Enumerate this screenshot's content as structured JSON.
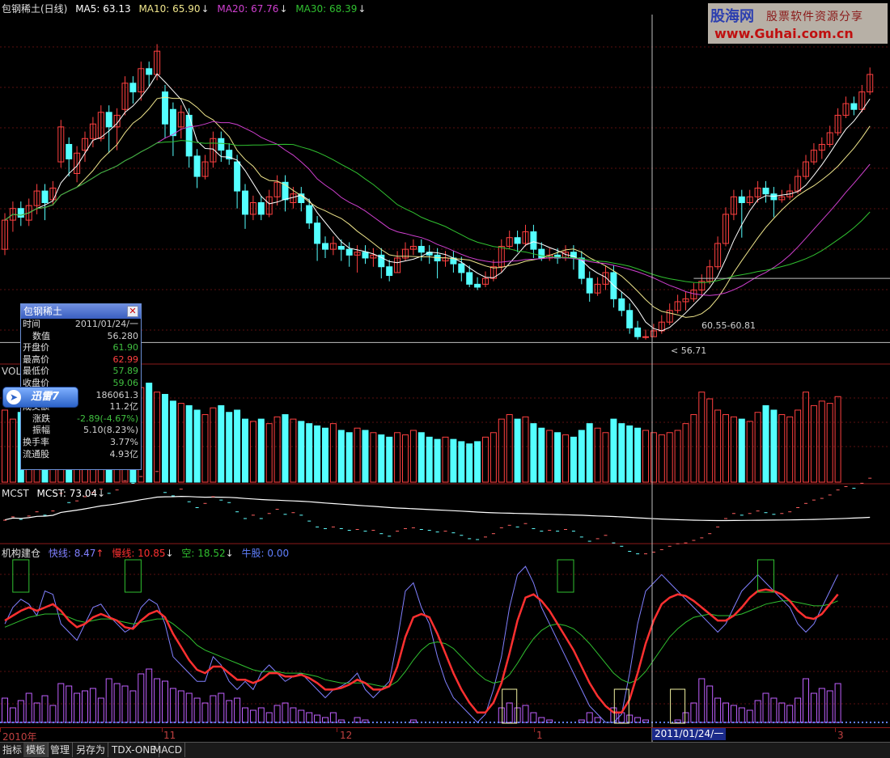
{
  "window": {
    "title": "包钢稀土(日线)"
  },
  "price_panel": {
    "name": "包钢稀土(日线)",
    "ma5_label": "MA5: 63.13",
    "ma10_label": "MA10: 65.90",
    "ma20_label": "MA20: 67.76",
    "ma30_label": "MA30: 68.39",
    "arrow": "↓",
    "ann_range": "60.55-60.81",
    "ann_low": "56.71",
    "colors": {
      "ma5": "#ffffff",
      "ma10": "#f0e68c",
      "ma20": "#d040d0",
      "ma30": "#30c030",
      "up": "#ff4040",
      "down": "#54ffff"
    }
  },
  "vol_panel": {
    "title": "VOL"
  },
  "mcst_panel": {
    "title": "MCST",
    "label": "MCST: 73.04",
    "arrow": "↓"
  },
  "jigou_panel": {
    "title": "机构建仓",
    "fast_label": "快线: 8.47",
    "fast_arrow": "↑",
    "slow_label": "慢线: 10.85",
    "slow_arrow": "↓",
    "kong_label": "空: 18.52",
    "kong_arrow": "↓",
    "niu_label": "牛股: 0.00",
    "colors": {
      "fast": "#8080ff",
      "slow": "#ff3030",
      "kong": "#30c030",
      "niu": "#6080ff"
    }
  },
  "info_box": {
    "title": "包钢稀土",
    "close_icon": "close-icon",
    "rows": [
      {
        "label": "时间",
        "value": "2011/01/24/一",
        "color": "#d0d0d0"
      },
      {
        "label": "数值",
        "value": "56.280",
        "color": "#d0d0d0"
      },
      {
        "label": "开盘价",
        "value": "61.90",
        "color": "#40c040"
      },
      {
        "label": "最高价",
        "value": "62.99",
        "color": "#ff4040"
      },
      {
        "label": "最低价",
        "value": "57.89",
        "color": "#40c040"
      },
      {
        "label": "收盘价",
        "value": "59.06",
        "color": "#40c040"
      },
      {
        "label": "成交量",
        "value": "186061.3",
        "color": "#d0d0d0"
      },
      {
        "label": "成交额",
        "value": "11.2亿",
        "color": "#d0d0d0"
      },
      {
        "label": "涨跌",
        "value": "-2.89(-4.67%)",
        "color": "#40c040"
      },
      {
        "label": "振幅",
        "value": "5.10(8.23%)",
        "color": "#d0d0d0"
      },
      {
        "label": "换手率",
        "value": "3.77%",
        "color": "#d0d0d0"
      },
      {
        "label": "流通股",
        "value": "4.93亿",
        "color": "#d0d0d0"
      }
    ]
  },
  "xunlei": {
    "label": "迅雷7",
    "icon": "xunlei-bird-icon"
  },
  "watermark": {
    "logo": "股海网",
    "slogan": "股票软件资源分享",
    "url": "www.Guhai.com.cn"
  },
  "date_axis": {
    "ticks": [
      "2010年",
      "11",
      "12",
      "1",
      "2011/01/24/一",
      "3"
    ]
  },
  "toolbar": {
    "buttons": [
      "指标",
      "模板",
      "管理",
      "另存为",
      "TDX-ONE",
      "MACD"
    ]
  },
  "chart_data": [
    {
      "type": "candlestick",
      "title": "包钢稀土(日线)",
      "series_names": [
        "MA5",
        "MA10",
        "MA20",
        "MA30"
      ],
      "candles_ocl": [
        [
          57.0,
          62.0,
          56.0
        ],
        [
          62.0,
          64.0,
          60.0
        ],
        [
          64.0,
          62.5,
          61.0
        ],
        [
          62.0,
          64.5,
          61.0
        ],
        [
          64.5,
          67.0,
          63.0
        ],
        [
          67.0,
          65.0,
          62.0
        ],
        [
          65.5,
          67.5,
          64.5
        ],
        [
          72.0,
          78.0,
          71.0
        ],
        [
          75.0,
          72.5,
          69.5
        ],
        [
          70.0,
          73.5,
          68.5
        ],
        [
          74.0,
          76.0,
          72.0
        ],
        [
          76.0,
          78.5,
          74.5
        ],
        [
          76.0,
          80.5,
          75.5
        ],
        [
          80.5,
          78.0,
          73.5
        ],
        [
          78.0,
          80.0,
          74.0
        ],
        [
          81.0,
          85.5,
          80.0
        ],
        [
          85.5,
          84.0,
          82.0
        ],
        [
          84.0,
          88.0,
          82.5
        ],
        [
          88.0,
          87.0,
          85.0
        ],
        [
          87.0,
          91.0,
          86.0
        ],
        [
          84.0,
          78.5,
          76.0
        ],
        [
          81.0,
          76.5,
          73.0
        ],
        [
          78.0,
          80.5,
          76.0
        ],
        [
          80.0,
          73.0,
          71.0
        ],
        [
          73.0,
          69.5,
          67.5
        ],
        [
          69.5,
          72.0,
          69.0
        ],
        [
          72.0,
          76.0,
          71.0
        ],
        [
          76.0,
          74.0,
          72.0
        ],
        [
          74.0,
          72.5,
          71.5
        ],
        [
          72.0,
          67.0,
          64.0
        ],
        [
          67.0,
          63.0,
          60.5
        ],
        [
          63.0,
          65.0,
          62.0
        ],
        [
          65.0,
          63.0,
          62.0
        ],
        [
          63.0,
          66.0,
          62.5
        ],
        [
          66.0,
          68.5,
          64.5
        ],
        [
          68.5,
          65.5,
          63.5
        ],
        [
          65.0,
          66.5,
          64.0
        ],
        [
          66.5,
          65.0,
          63.5
        ],
        [
          64.5,
          61.5,
          60.5
        ],
        [
          61.5,
          58.0,
          55.0
        ],
        [
          58.0,
          57.0,
          55.5
        ],
        [
          57.0,
          58.0,
          56.0
        ],
        [
          57.5,
          57.0,
          55.0
        ],
        [
          57.0,
          56.0,
          54.0
        ],
        [
          56.0,
          56.5,
          53.0
        ],
        [
          56.5,
          55.5,
          54.5
        ],
        [
          55.5,
          56.0,
          54.0
        ],
        [
          56.0,
          54.0,
          52.0
        ],
        [
          54.0,
          52.5,
          51.5
        ],
        [
          53.0,
          55.5,
          53.0
        ],
        [
          55.5,
          57.0,
          55.0
        ],
        [
          57.0,
          57.5,
          56.0
        ],
        [
          57.5,
          56.5,
          55.0
        ],
        [
          56.5,
          56.0,
          54.5
        ],
        [
          56.0,
          55.0,
          52.0
        ],
        [
          55.0,
          55.5,
          54.0
        ],
        [
          55.5,
          54.5,
          53.0
        ],
        [
          54.5,
          53.0,
          51.5
        ],
        [
          53.0,
          51.0,
          50.5
        ],
        [
          51.0,
          50.5,
          50.0
        ],
        [
          51.0,
          52.0,
          50.5
        ],
        [
          52.0,
          54.0,
          51.5
        ],
        [
          54.0,
          57.5,
          53.0
        ],
        [
          57.5,
          59.0,
          57.0
        ],
        [
          59.0,
          58.0,
          56.5
        ],
        [
          58.0,
          60.0,
          57.5
        ],
        [
          60.0,
          57.0,
          55.5
        ],
        [
          57.0,
          55.5,
          55.0
        ],
        [
          55.5,
          56.0,
          55.0
        ],
        [
          56.0,
          55.5,
          54.5
        ],
        [
          55.5,
          56.5,
          55.0
        ],
        [
          56.5,
          55.5,
          53.5
        ],
        [
          55.5,
          52.0,
          51.0
        ],
        [
          52.0,
          49.5,
          48.0
        ],
        [
          49.5,
          51.0,
          49.0
        ],
        [
          51.0,
          53.0,
          50.0
        ],
        [
          53.0,
          48.5,
          47.0
        ],
        [
          48.5,
          46.5,
          45.5
        ],
        [
          46.5,
          43.5,
          42.5
        ],
        [
          43.5,
          42.0,
          41.5
        ],
        [
          42.0,
          42.0,
          41.5
        ],
        [
          42.0,
          43.0,
          42.0
        ],
        [
          43.0,
          44.5,
          42.5
        ],
        [
          44.5,
          46.5,
          44.0
        ],
        [
          46.5,
          48.0,
          46.0
        ],
        [
          48.0,
          48.5,
          46.5
        ],
        [
          48.5,
          50.0,
          48.0
        ],
        [
          50.0,
          51.5,
          49.0
        ],
        [
          51.5,
          54.0,
          51.0
        ],
        [
          54.0,
          58.0,
          53.5
        ],
        [
          58.0,
          63.0,
          57.5
        ],
        [
          63.0,
          66.0,
          62.0
        ],
        [
          66.0,
          65.0,
          59.0
        ],
        [
          65.0,
          66.0,
          64.5
        ],
        [
          66.0,
          67.5,
          65.0
        ],
        [
          67.5,
          66.5,
          65.0
        ],
        [
          66.5,
          65.5,
          62.5
        ],
        [
          65.5,
          66.0,
          65.0
        ],
        [
          66.0,
          67.0,
          65.5
        ],
        [
          67.0,
          69.5,
          66.5
        ],
        [
          69.5,
          72.0,
          69.0
        ],
        [
          72.0,
          74.0,
          71.5
        ],
        [
          74.0,
          75.0,
          72.5
        ],
        [
          75.0,
          77.0,
          74.5
        ],
        [
          77.0,
          80.0,
          76.5
        ],
        [
          80.0,
          82.0,
          79.5
        ],
        [
          82.0,
          81.0,
          80.0
        ],
        [
          81.0,
          84.0,
          80.5
        ],
        [
          84.0,
          87.0,
          83.5
        ]
      ],
      "ylim": [
        38,
        97
      ]
    },
    {
      "type": "bar",
      "title": "VOL",
      "values": [
        160,
        140,
        155,
        170,
        150,
        165,
        145,
        190,
        185,
        170,
        175,
        180,
        160,
        200,
        190,
        185,
        175,
        210,
        220,
        200,
        195,
        180,
        175,
        170,
        160,
        150,
        165,
        170,
        155,
        160,
        140,
        135,
        140,
        130,
        145,
        150,
        140,
        135,
        130,
        125,
        120,
        130,
        115,
        110,
        120,
        115,
        110,
        105,
        100,
        110,
        105,
        115,
        110,
        100,
        95,
        100,
        95,
        90,
        85,
        90,
        100,
        110,
        140,
        150,
        140,
        145,
        130,
        120,
        115,
        110,
        105,
        100,
        115,
        130,
        120,
        110,
        140,
        130,
        125,
        120,
        115,
        110,
        105,
        110,
        115,
        130,
        150,
        200,
        185,
        160,
        150,
        145,
        140,
        135,
        155,
        170,
        160,
        150,
        145,
        160,
        200,
        170,
        180,
        175,
        190
      ],
      "ylim": [
        0,
        230
      ]
    },
    {
      "type": "line",
      "title": "MCST",
      "series_names": [
        "MCST"
      ],
      "ylim": [
        40,
        100
      ]
    },
    {
      "type": "line",
      "title": "机构建仓",
      "series_names": [
        "快线",
        "慢线",
        "空",
        "牛股"
      ],
      "fast": [
        60,
        70,
        75,
        72,
        65,
        80,
        78,
        60,
        55,
        50,
        60,
        70,
        72,
        65,
        60,
        55,
        58,
        70,
        75,
        72,
        60,
        40,
        35,
        30,
        25,
        25,
        40,
        35,
        25,
        20,
        25,
        20,
        30,
        35,
        30,
        25,
        28,
        30,
        25,
        20,
        15,
        20,
        22,
        25,
        30,
        20,
        15,
        20,
        25,
        50,
        80,
        85,
        70,
        60,
        40,
        25,
        15,
        10,
        5,
        0,
        5,
        20,
        40,
        70,
        90,
        95,
        85,
        70,
        60,
        50,
        40,
        30,
        20,
        10,
        5,
        0,
        0,
        5,
        30,
        60,
        80,
        85,
        90,
        85,
        80,
        75,
        70,
        65,
        60,
        55,
        60,
        70,
        80,
        85,
        90,
        85,
        80,
        75,
        70,
        60,
        55,
        60,
        70,
        80,
        90
      ],
      "slow": [
        62,
        65,
        68,
        70,
        68,
        70,
        72,
        68,
        62,
        58,
        60,
        64,
        66,
        64,
        62,
        58,
        57,
        62,
        66,
        68,
        64,
        54,
        46,
        38,
        32,
        30,
        34,
        34,
        30,
        26,
        26,
        24,
        26,
        30,
        30,
        28,
        28,
        29,
        27,
        24,
        20,
        20,
        21,
        23,
        26,
        24,
        20,
        20,
        22,
        34,
        52,
        64,
        66,
        64,
        54,
        42,
        30,
        20,
        12,
        6,
        6,
        12,
        24,
        42,
        62,
        76,
        78,
        74,
        68,
        60,
        52,
        44,
        34,
        24,
        16,
        10,
        6,
        6,
        14,
        30,
        48,
        62,
        72,
        76,
        78,
        77,
        74,
        70,
        66,
        62,
        62,
        65,
        70,
        76,
        80,
        81,
        80,
        78,
        74,
        68,
        64,
        63,
        66,
        72,
        78
      ],
      "kong": [
        58,
        60,
        62,
        64,
        65,
        66,
        66,
        66,
        64,
        62,
        61,
        62,
        63,
        63,
        62,
        61,
        60,
        61,
        62,
        63,
        63,
        60,
        56,
        52,
        47,
        44,
        42,
        40,
        38,
        36,
        34,
        32,
        31,
        31,
        31,
        30,
        30,
        30,
        29,
        28,
        26,
        25,
        24,
        24,
        24,
        24,
        23,
        22,
        22,
        25,
        31,
        38,
        44,
        48,
        49,
        48,
        45,
        40,
        35,
        30,
        26,
        24,
        25,
        29,
        36,
        44,
        51,
        56,
        59,
        60,
        59,
        57,
        53,
        48,
        42,
        36,
        30,
        26,
        24,
        26,
        31,
        38,
        45,
        52,
        57,
        61,
        64,
        65,
        66,
        65,
        65,
        65,
        66,
        68,
        70,
        72,
        73,
        74,
        74,
        73,
        72,
        71,
        71,
        72,
        74
      ],
      "niu": [
        0,
        0,
        0,
        0,
        0,
        0,
        0,
        0,
        0,
        0,
        0,
        0,
        0,
        0,
        0,
        0,
        0,
        0,
        0,
        0,
        0,
        0,
        0,
        0,
        0,
        0,
        0,
        0,
        0,
        0,
        0,
        0,
        0,
        0,
        0,
        0,
        0,
        0,
        0,
        0,
        0,
        0,
        0,
        0,
        0,
        0,
        0,
        0,
        0,
        0,
        0,
        0,
        0,
        0,
        0,
        0,
        0,
        0,
        0,
        0,
        0,
        0,
        0,
        0,
        0,
        0,
        0,
        0,
        0,
        0,
        0,
        0,
        0,
        0,
        0,
        0,
        0,
        0,
        0,
        0,
        0,
        0,
        0,
        0,
        0,
        0,
        0,
        0,
        0,
        0,
        0,
        0,
        0,
        0,
        0,
        0,
        0,
        0,
        0,
        0,
        0,
        0,
        0,
        0,
        0
      ],
      "ylim": [
        0,
        100
      ]
    }
  ]
}
